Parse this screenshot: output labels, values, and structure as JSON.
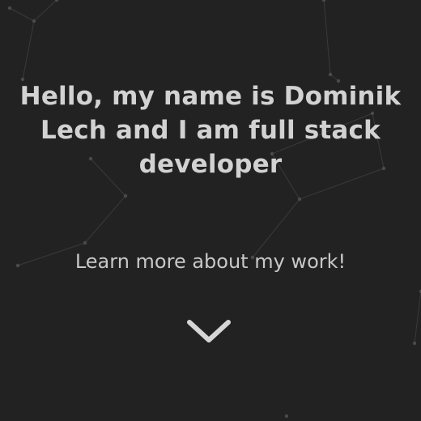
{
  "hero": {
    "headline": "Hello, my name is Dominik Lech and I am full stack developer",
    "subtitle": "Learn more about my work!",
    "scroll_icon": "chevron-down-icon"
  },
  "colors": {
    "background": "#222222",
    "text": "#d2d2d2",
    "network_lines": "#3a3a3a"
  }
}
